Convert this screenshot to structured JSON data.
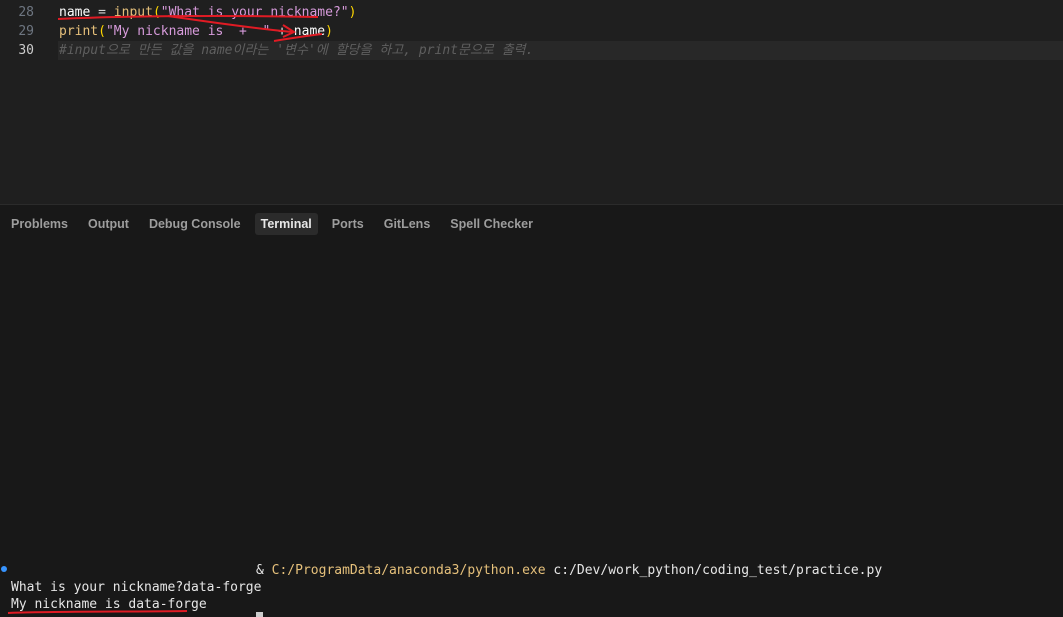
{
  "editor": {
    "lines": [
      {
        "number": "28",
        "tokens": [
          "name",
          " = ",
          "input",
          "(",
          "\"What is your nickname?\"",
          ")"
        ]
      },
      {
        "number": "29",
        "tokens": [
          "print",
          "(",
          "\"My nickname is  +  \" ",
          "+ name",
          ")"
        ]
      },
      {
        "number": "30",
        "comment": "#input으로 만든 값을 name이라는 '변수'에 할당을 하고, print문으로 출력."
      }
    ]
  },
  "panel": {
    "tabs": [
      "Problems",
      "Output",
      "Debug Console",
      "Terminal",
      "Ports",
      "GitLens",
      "Spell Checker"
    ],
    "active_tab": "Terminal"
  },
  "terminal": {
    "command_prefix": "& ",
    "python_path": "C:/ProgramData/anaconda3/python.exe",
    "script_path": " c:/Dev/work_python/coding_test/practice.py",
    "output_line_1": "What is your nickname?data-forge",
    "output_line_2": "My nickname is data-forge"
  },
  "colors": {
    "annotation": "#e01b24",
    "accent": "#3794ff"
  }
}
